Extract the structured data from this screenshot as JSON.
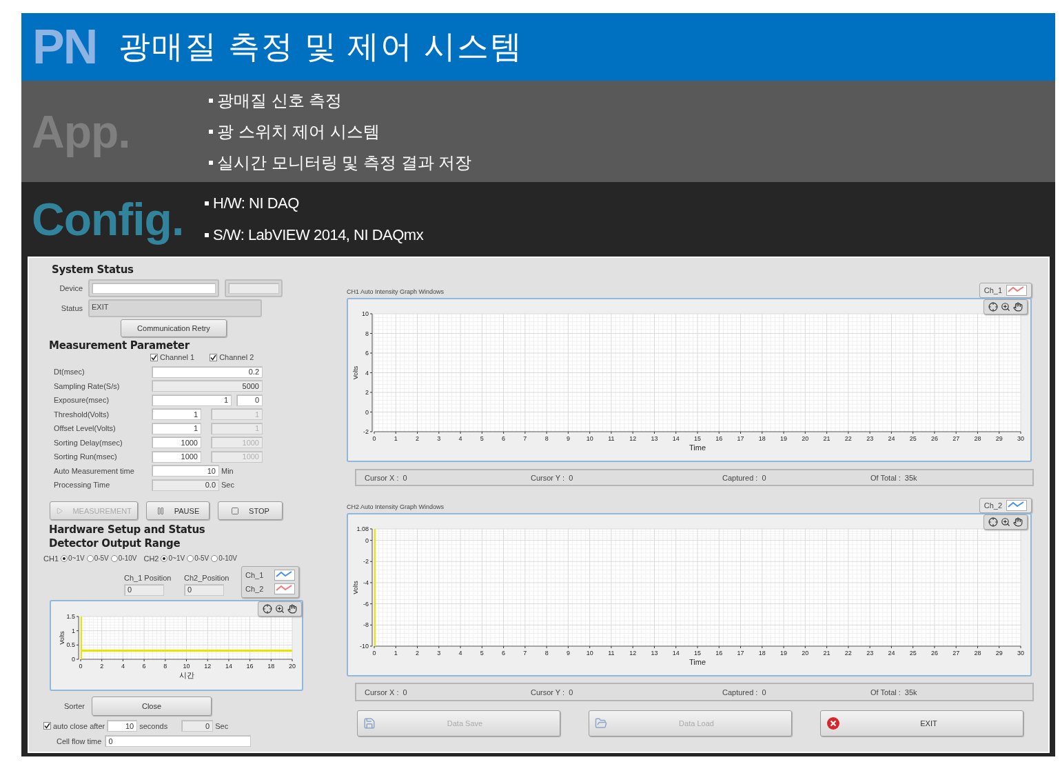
{
  "header": {
    "logo": "PN",
    "title": "광매질 측정 및 제어 시스템"
  },
  "app": {
    "heading": "App.",
    "bullets": [
      "광매질 신호 측정",
      "광 스위치 제어 시스템",
      "실시간 모니터링 및 측정 결과 저장"
    ]
  },
  "config": {
    "heading": "Config.",
    "bullets": [
      "H/W: NI DAQ",
      "S/W: LabVIEW 2014, NI DAQmx"
    ]
  },
  "panel": {
    "system_status": {
      "title": "System Status",
      "device_label": "Device",
      "status_label": "Status",
      "status_value": "EXIT",
      "retry_button": "Communication Retry"
    },
    "measurement": {
      "title": "Measurement Parameter",
      "channels": [
        {
          "label": "Channel 1",
          "checked": true
        },
        {
          "label": "Channel 2",
          "checked": true
        }
      ],
      "rows": [
        {
          "label": "Dt(msec)",
          "kind": "wide",
          "readonly": false,
          "value": "0.2"
        },
        {
          "label": "Sampling Rate(S/s)",
          "kind": "wide",
          "readonly": true,
          "value": "5000"
        },
        {
          "label": "Exposure(msec)",
          "kind": "split",
          "readonly": false,
          "value": "1",
          "value_2": "0"
        },
        {
          "label": "Threshold(Volts)",
          "kind": "pair",
          "readonly": false,
          "value": "1",
          "value_2": "1"
        },
        {
          "label": "Offset Level(Volts)",
          "kind": "pair",
          "readonly": false,
          "value": "1",
          "value_2": "1"
        },
        {
          "label": "Sorting Delay(msec)",
          "kind": "pair",
          "readonly": false,
          "value": "1000",
          "value_2": "1000"
        },
        {
          "label": "Sorting Run(msec)",
          "kind": "pair",
          "readonly": false,
          "value": "1000",
          "value_2": "1000"
        },
        {
          "label": "Auto Measurement time",
          "kind": "unit",
          "readonly": false,
          "value": "10",
          "unit": "Min"
        },
        {
          "label": "Processing Time",
          "kind": "unit",
          "readonly": true,
          "value": "0.0",
          "unit": "Sec"
        }
      ]
    },
    "controls": [
      {
        "label": "MEASUREMENT",
        "kind": "play",
        "disabled": true
      },
      {
        "label": "PAUSE",
        "kind": "pause",
        "disabled": false
      },
      {
        "label": "STOP",
        "kind": "stop",
        "disabled": false
      }
    ],
    "hardware": {
      "title": "Hardware Setup and Status",
      "subtitle": "Detector Output Range",
      "ranges": [
        {
          "label": "CH1",
          "options": [
            {
              "label": "0~1V",
              "selected": true
            },
            {
              "label": "0-5V",
              "selected": false
            },
            {
              "label": "0-10V",
              "selected": false
            }
          ]
        },
        {
          "label": "CH2",
          "options": [
            {
              "label": "0~1V",
              "selected": true
            },
            {
              "label": "0-5V",
              "selected": false
            },
            {
              "label": "0-10V",
              "selected": false
            }
          ]
        }
      ],
      "positions": [
        {
          "label": "Ch_1 Position",
          "value": "0"
        },
        {
          "label": "Ch2_Position",
          "value": "0"
        }
      ],
      "legend": [
        {
          "label": "Ch_1",
          "color": "#4a90e2"
        },
        {
          "label": "Ch_2",
          "color": "#f07878"
        }
      ],
      "chart_data": {
        "type": "line",
        "grid": true,
        "xlabel": "시간",
        "ylabel": "Volts",
        "xlim": [
          0,
          20
        ],
        "ylim": [
          0,
          1.5
        ],
        "xticks": [
          0,
          2,
          4,
          6,
          8,
          10,
          12,
          14,
          16,
          18,
          20
        ],
        "yticks": [
          0,
          0.5,
          1,
          1.5
        ],
        "x": [
          0,
          20
        ],
        "series": [
          {
            "color": "#e6e600",
            "values": [
              0.3,
              0.3
            ]
          }
        ],
        "ref_lines": [
          {
            "axis": "x",
            "value": 0,
            "color": "#e6e600"
          }
        ]
      }
    },
    "sorter": {
      "label": "Sorter",
      "button": "Close"
    },
    "auto_close": {
      "checked": true,
      "label": "auto close after",
      "value": "10",
      "unit": "seconds",
      "counter": "0",
      "counter_unit": "Sec"
    },
    "cell_flow": {
      "label": "Cell flow time",
      "value": "0"
    },
    "graphs": [
      {
        "title": "CH1 Auto Intensity Graph Windows",
        "legend": {
          "label": "Ch_1",
          "color": "#f07878"
        },
        "chart_data": {
          "type": "line",
          "grid": true,
          "xlabel": "Time",
          "ylabel": "Volts",
          "xlim": [
            0,
            30
          ],
          "ylim": [
            -2,
            10
          ],
          "xticks": [
            0,
            1,
            2,
            3,
            4,
            5,
            6,
            7,
            8,
            9,
            10,
            11,
            12,
            13,
            14,
            15,
            16,
            17,
            18,
            19,
            20,
            21,
            22,
            23,
            24,
            25,
            26,
            27,
            28,
            29,
            30
          ],
          "yticks": [
            -2,
            0,
            2,
            4,
            6,
            8,
            10
          ]
        },
        "status": [
          {
            "label": "Cursor X :",
            "value": "0"
          },
          {
            "label": "Cursor Y :",
            "value": "0"
          },
          {
            "label": "Captured :",
            "value": "0"
          },
          {
            "label": "Of Total :",
            "value": "35k"
          }
        ]
      },
      {
        "title": "CH2 Auto Intensity Graph Windows",
        "legend": {
          "label": "Ch_2",
          "color": "#4a90e2"
        },
        "chart_data": {
          "type": "line",
          "grid": true,
          "xlabel": "Time",
          "ylabel": "Volts",
          "xlim": [
            0,
            30
          ],
          "ylim": [
            -10,
            1.08
          ],
          "xticks": [
            0,
            1,
            2,
            3,
            4,
            5,
            6,
            7,
            8,
            9,
            10,
            11,
            12,
            13,
            14,
            15,
            16,
            17,
            18,
            19,
            20,
            21,
            22,
            23,
            24,
            25,
            26,
            27,
            28,
            29,
            30
          ],
          "yticks": [
            -10,
            -8,
            -6,
            -4,
            -2,
            0,
            1.08
          ],
          "ref_lines": [
            {
              "axis": "x",
              "value": 0,
              "color": "#e6e600"
            }
          ]
        },
        "status": [
          {
            "label": "Cursor X :",
            "value": "0"
          },
          {
            "label": "Cursor Y :",
            "value": "0"
          },
          {
            "label": "Captured :",
            "value": "0"
          },
          {
            "label": "Of Total :",
            "value": "35k"
          }
        ]
      }
    ],
    "bottom_buttons": [
      {
        "label": "Data Save",
        "kind": "save",
        "disabled": true
      },
      {
        "label": "Data Load",
        "kind": "load",
        "disabled": true
      },
      {
        "label": "EXIT",
        "kind": "exit",
        "disabled": false
      }
    ]
  }
}
